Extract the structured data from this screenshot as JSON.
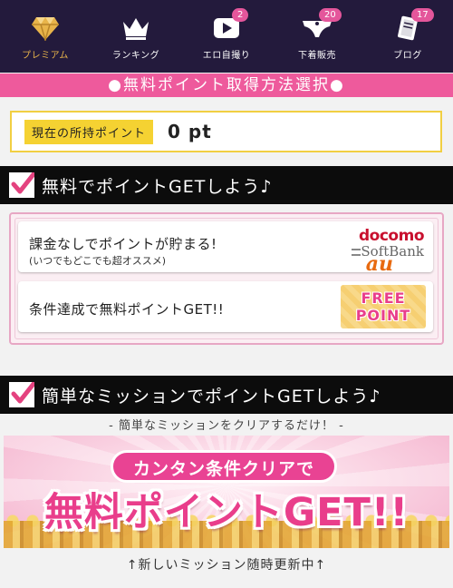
{
  "nav": {
    "items": [
      {
        "label": "プレミアム",
        "icon": "diamond-icon",
        "badge": ""
      },
      {
        "label": "ランキング",
        "icon": "crown-icon",
        "badge": ""
      },
      {
        "label": "エロ自撮り",
        "icon": "video-play-icon",
        "badge": "2"
      },
      {
        "label": "下着販売",
        "icon": "underwear-icon",
        "badge": "20"
      },
      {
        "label": "ブログ",
        "icon": "notebook-icon",
        "badge": "17"
      }
    ],
    "active_color": "#e8b44a"
  },
  "banner_title": "●無料ポイント取得方法選択●",
  "points": {
    "label": "現在の所持ポイント",
    "value": "0 pt"
  },
  "section1": {
    "title": "無料でポイントGETしよう♪"
  },
  "cards": [
    {
      "title": "課金なしでポイントが貯まる!",
      "subtitle": "(いつでもどこでも超オススメ)",
      "carriers": [
        "docomo",
        "SoftBank",
        "au"
      ]
    },
    {
      "title": "条件達成で無料ポイントGET!!",
      "badge_line1": "FREE",
      "badge_line2": "POINT"
    }
  ],
  "section2": {
    "title": "簡単なミッションでポイントGETしよう♪",
    "caption": "- 簡単なミッションをクリアするだけ！ -"
  },
  "mission_banner": {
    "pill": "カンタン条件クリアで",
    "headline": "無料ポイントGET!!"
  },
  "footer_caption": "↑新しいミッション随時更新中↑",
  "colors": {
    "nav_bg": "#231a3c",
    "pink": "#ee5a9c",
    "yellow": "#f5d232",
    "accent": "#e93e8b"
  }
}
